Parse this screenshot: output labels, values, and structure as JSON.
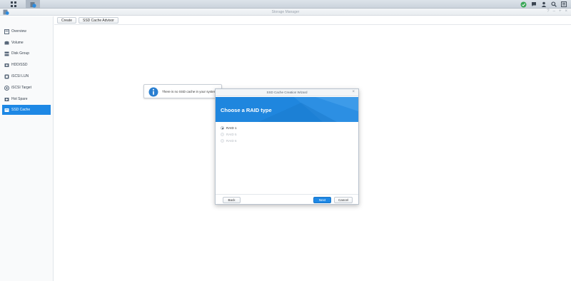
{
  "window": {
    "title": "Storage Manager"
  },
  "toolbar": {
    "create_label": "Create",
    "advisor_label": "SSD Cache Advisor"
  },
  "sidebar": {
    "items": [
      {
        "label": "Overview",
        "icon": "overview-icon"
      },
      {
        "label": "Volume",
        "icon": "volume-icon"
      },
      {
        "label": "Disk Group",
        "icon": "disk-group-icon"
      },
      {
        "label": "HDD/SSD",
        "icon": "hdd-icon"
      },
      {
        "label": "iSCSI LUN",
        "icon": "iscsi-lun-icon"
      },
      {
        "label": "iSCSI Target",
        "icon": "iscsi-target-icon"
      },
      {
        "label": "Hot Spare",
        "icon": "hot-spare-icon"
      },
      {
        "label": "SSD Cache",
        "icon": "ssd-cache-icon",
        "active": true
      }
    ]
  },
  "notice": {
    "message": "There is no SSD cache in your system"
  },
  "wizard": {
    "title": "SSD Cache Creation Wizard",
    "heading": "Choose a RAID type",
    "options": [
      {
        "label": "RAID 1",
        "selected": true,
        "enabled": true
      },
      {
        "label": "RAID 5",
        "selected": false,
        "enabled": false
      },
      {
        "label": "RAID 6",
        "selected": false,
        "enabled": false
      }
    ],
    "back_label": "Back",
    "next_label": "Next",
    "cancel_label": "Cancel"
  },
  "colors": {
    "accent": "#1e88e5",
    "banner": "#1f86de"
  }
}
